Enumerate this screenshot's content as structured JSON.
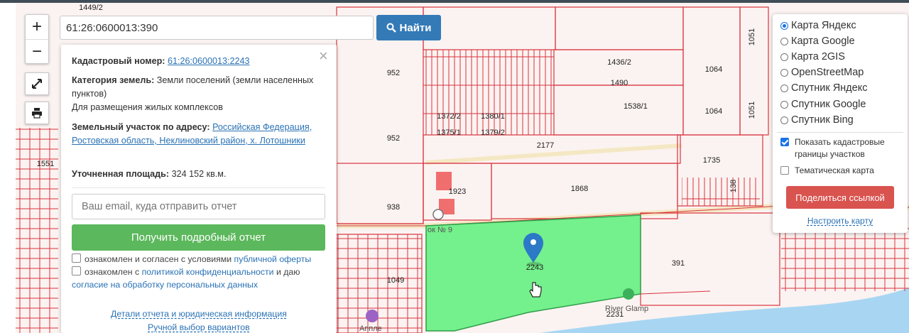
{
  "map": {
    "parcel_labels": [
      "1449/2",
      "952",
      "952",
      "938",
      "1049",
      "1551",
      "1436/2",
      "1490",
      "1538/1",
      "1064",
      "1064",
      "1051",
      "1051",
      "1372/2",
      "1380/1",
      "1375/1",
      "1379/2",
      "2177",
      "1923",
      "1868",
      "1735",
      "138",
      "2243",
      "391",
      "2231"
    ],
    "poi_labels": [
      "ок № 9",
      "River Glamp",
      "Аппле"
    ],
    "colors": {
      "parcel_line": "#d9333f",
      "selected_fill": "#74f08c",
      "background": "#fbf3f1",
      "water": "#a8d6f2"
    }
  },
  "controls": {
    "zoom_in": "+",
    "zoom_out": "−",
    "fullscreen_icon": "expand-icon",
    "print_icon": "printer-icon"
  },
  "search": {
    "value": "61:26:0600013:390",
    "button_label": "Найти",
    "button_icon": "search-icon"
  },
  "info": {
    "close": "×",
    "cadastral_label": "Кадастровый номер:",
    "cadastral_value": "61:26:0600013:2243",
    "category_label": "Категория земель:",
    "category_value": "Земли поселений (земли населенных пунктов)",
    "usage": "Для размещения жилых комплексов",
    "address_label": "Земельный участок по адресу:",
    "address_value": "Российская Федерация, Ростовская область, Неклиновский район, х. Лотошники",
    "area_label": "Уточненная площадь:",
    "area_value": "324 152 кв.м.",
    "email_placeholder": "Ваш email, куда отправить отчет",
    "report_button": "Получить подробный отчет",
    "consent1_text": "ознакомлен и согласен с условиями",
    "consent1_link": "публичной оферты",
    "consent2_text": "ознакомлен с",
    "consent2_link": "политикой конфиденциальности",
    "consent2_mid": "и даю",
    "consent2_link2": "согласие на обработку персональных данных",
    "details_link": "Детали отчета и юридическая информация",
    "manual_link": "Ручной выбор вариантов"
  },
  "layers": {
    "options": [
      "Карта Яндекс",
      "Карта Google",
      "Карта 2GIS",
      "OpenStreetMap",
      "Спутник Яндекс",
      "Спутник Google",
      "Спутник Bing"
    ],
    "selected": "Карта Яндекс",
    "show_borders": "Показать кадастровые границы участков",
    "show_borders_checked": true,
    "thematic": "Тематическая карта",
    "thematic_checked": false,
    "share_button": "Поделиться ссылкой",
    "setup_link": "Настроить карту"
  }
}
